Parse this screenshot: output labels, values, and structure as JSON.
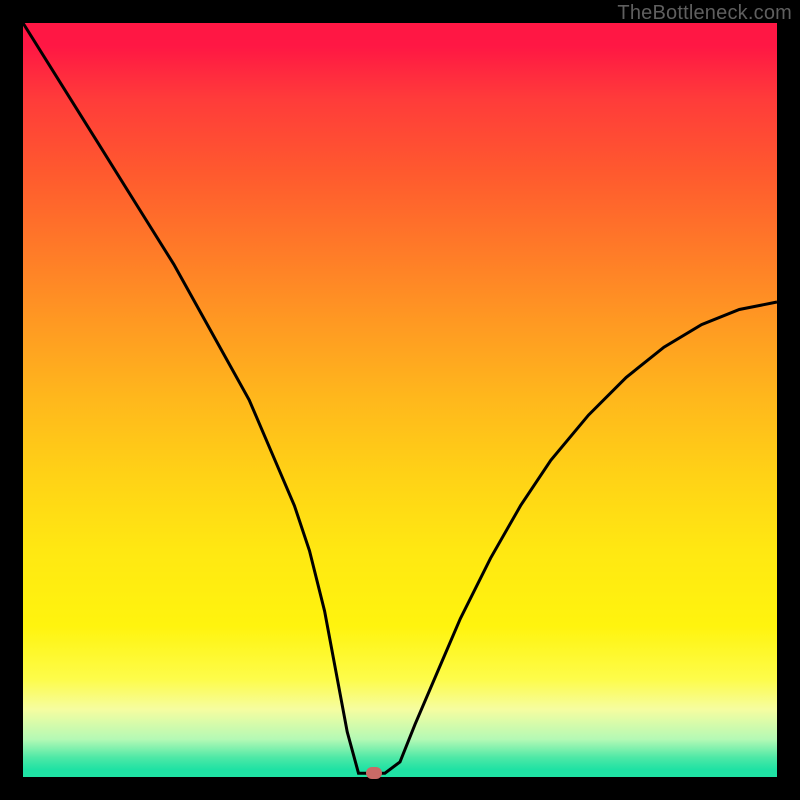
{
  "watermark": "TheBottleneck.com",
  "colors": {
    "frame": "#000000",
    "curve": "#000000",
    "marker": "#c96a66",
    "gradient_top": "#ff1744",
    "gradient_bottom": "#1fe2a4"
  },
  "chart_data": {
    "type": "line",
    "title": "",
    "xlabel": "",
    "ylabel": "",
    "xlim": [
      0,
      100
    ],
    "ylim": [
      0,
      100
    ],
    "grid": false,
    "legend": false,
    "series": [
      {
        "name": "bottleneck-curve",
        "x": [
          0,
          5,
          10,
          15,
          20,
          25,
          30,
          33,
          36,
          38,
          40,
          41.5,
          43,
          44.5,
          46,
          48,
          50,
          52,
          55,
          58,
          62,
          66,
          70,
          75,
          80,
          85,
          90,
          95,
          100
        ],
        "y": [
          100,
          92,
          84,
          76,
          68,
          59,
          50,
          43,
          36,
          30,
          22,
          14,
          6,
          0.5,
          0.5,
          0.5,
          2,
          7,
          14,
          21,
          29,
          36,
          42,
          48,
          53,
          57,
          60,
          62,
          63
        ]
      }
    ],
    "annotations": [
      {
        "name": "optimal-point",
        "x": 46.5,
        "y": 0.5,
        "color": "#c96a66"
      }
    ],
    "background": "vertical-gradient red→yellow→green"
  }
}
